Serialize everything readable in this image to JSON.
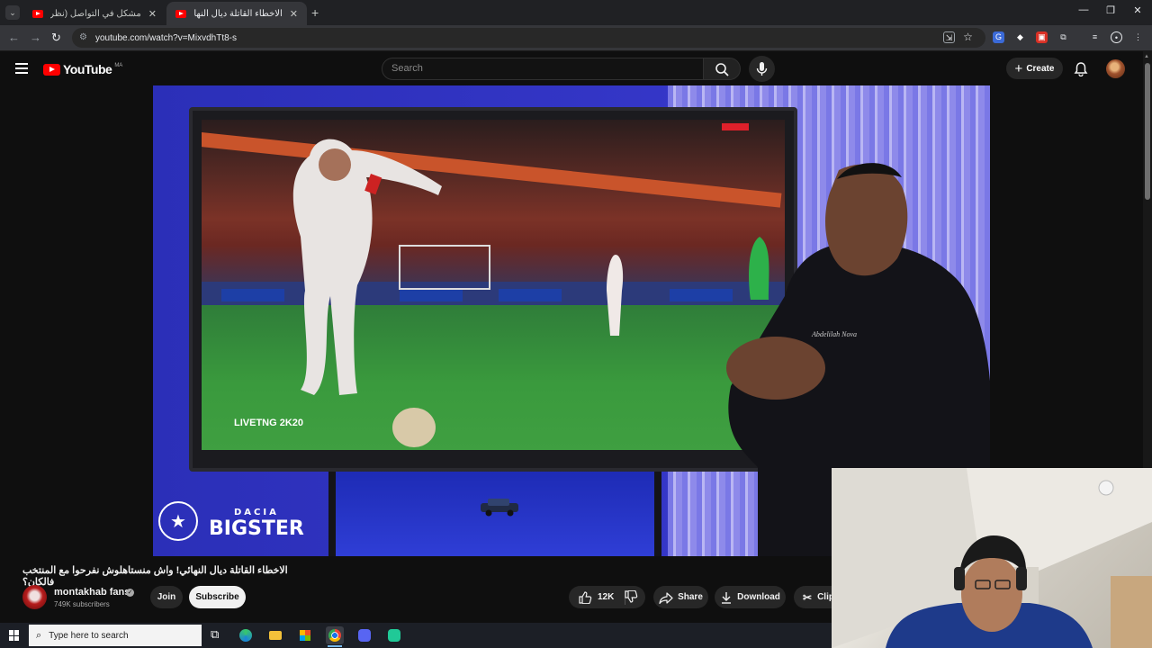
{
  "browser": {
    "tabs": [
      {
        "title": "مشكل في التواصل (نظرية البرانك..."
      },
      {
        "title": "الاخطاء القاتلة ديال النهائي! واش..."
      }
    ],
    "new_tab_icon": "plus-icon",
    "url": "youtube.com/watch?v=MixvdhTt8-s"
  },
  "youtube": {
    "logo_text": "YouTube",
    "country_code": "MA",
    "search_placeholder": "Search",
    "create_label": "Create"
  },
  "video": {
    "overlay_brand_small": "DACIA",
    "overlay_brand_large": "BIGSTER",
    "watermark": "LIVETNG 2K20"
  },
  "info": {
    "title": "الاخطاء القاتلة ديال النهائي! واش منستاهلوش نفرحوا مع المنتخب فالكان؟",
    "channel_name": "montakhab fans",
    "subscribers": "749K subscribers",
    "join_label": "Join",
    "subscribe_label": "Subscribe",
    "like_count": "12K",
    "share_label": "Share",
    "download_label": "Download",
    "clip_label": "Clip"
  },
  "taskbar": {
    "search_placeholder": "Type here to search"
  },
  "colors": {
    "youtube_red": "#ff0000",
    "page_bg": "#0f0f0f",
    "pill_bg": "#272727"
  }
}
